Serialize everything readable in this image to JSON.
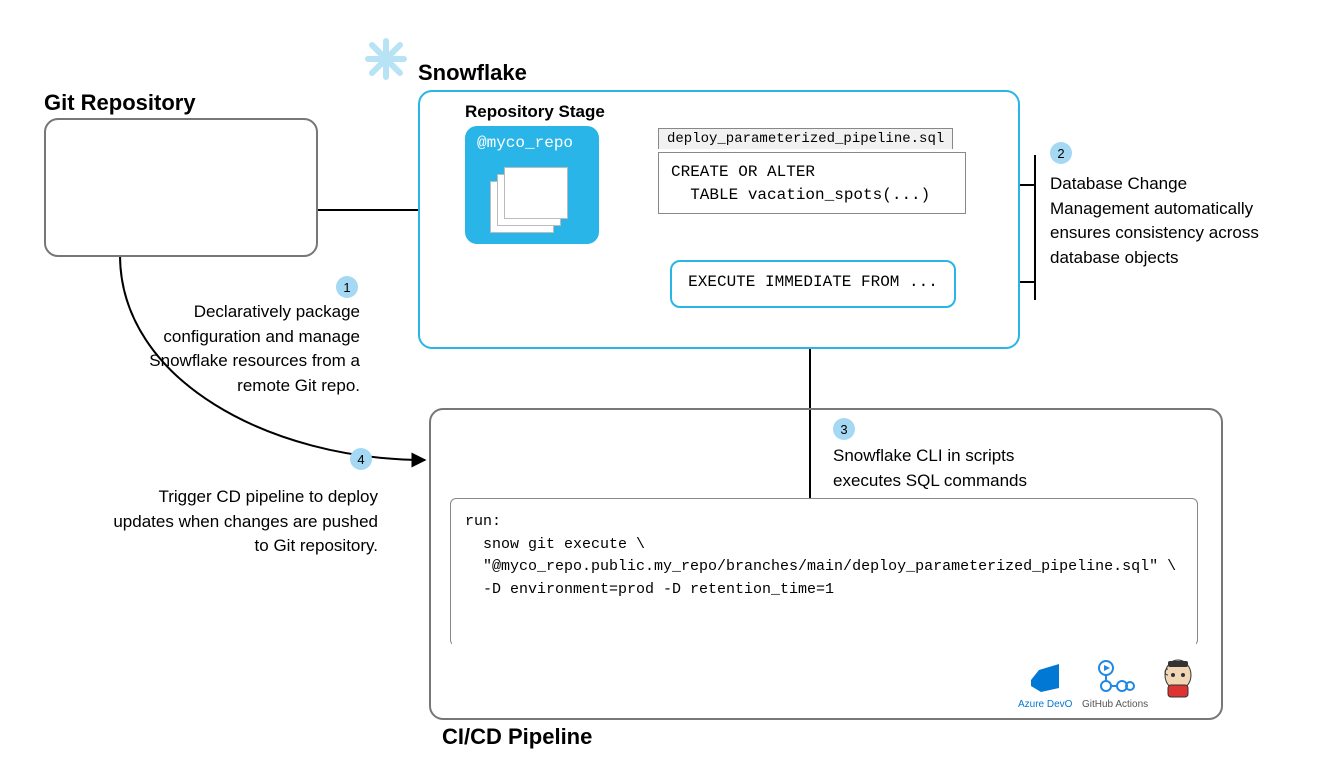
{
  "titles": {
    "git": "Git Repository",
    "snowflake": "Snowflake",
    "repo_stage": "Repository Stage",
    "repo_name": "@myco_repo",
    "cicd": "CI/CD Pipeline"
  },
  "file": {
    "name": "deploy_parameterized_pipeline.sql",
    "content": "CREATE OR ALTER\n  TABLE vacation_spots(...)"
  },
  "exec_box": "EXECUTE IMMEDIATE FROM ...",
  "annotations": {
    "n1": "Declaratively package configuration and manage Snowflake resources from a remote Git repo.",
    "n2": "Database Change Management automatically ensures consistency across database objects",
    "n3": "Snowflake CLI in scripts executes SQL commands",
    "n4": "Trigger CD pipeline to deploy updates when changes are pushed to Git repository."
  },
  "badges": {
    "n1": "1",
    "n2": "2",
    "n3": "3",
    "n4": "4"
  },
  "script": "run:\n  snow git execute \\\n  \"@myco_repo.public.my_repo/branches/main/deploy_parameterized_pipeline.sql\" \\\n  -D environment=prod -D retention_time=1",
  "icons": {
    "azure": "Azure DevO",
    "gha": "GitHub Actions",
    "jenkins": "Jenkins"
  }
}
